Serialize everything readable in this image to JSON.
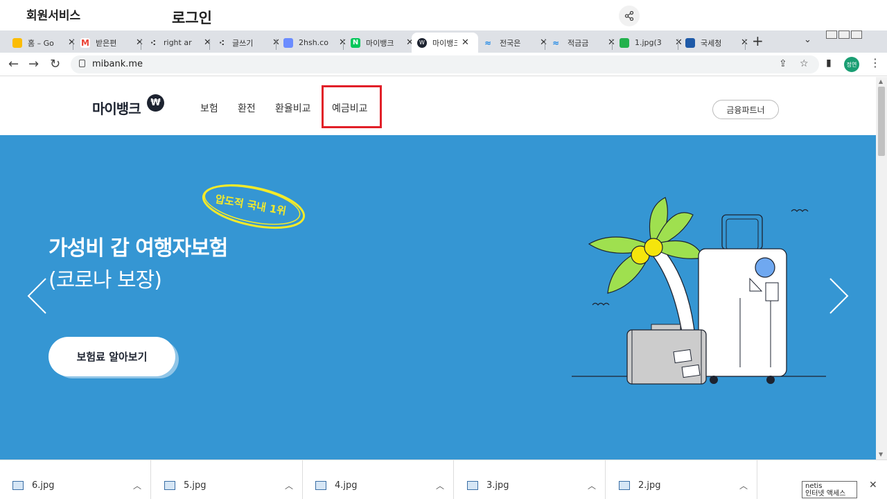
{
  "overlay": {
    "member_service": "회원서비스",
    "login": "로그인"
  },
  "tabs": [
    {
      "label": "홈 – Go",
      "icon": "google-ads-icon",
      "color": "#fbbc04"
    },
    {
      "label": "받은편",
      "icon": "gmail-icon",
      "color": "#ea4335"
    },
    {
      "label": "right ar",
      "icon": "tistory-icon",
      "color": "#333333"
    },
    {
      "label": "글쓰기",
      "icon": "tistory-icon",
      "color": "#333333"
    },
    {
      "label": "2hsh.co",
      "icon": "doc-icon",
      "color": "#6b8cff"
    },
    {
      "label": "마이뱅크",
      "icon": "naver-icon",
      "color": "#03c75a"
    },
    {
      "label": "마이뱅크",
      "icon": "mibank-icon",
      "color": "#1d2330"
    },
    {
      "label": "전국은",
      "icon": "bank-icon",
      "color": "#1e88e5"
    },
    {
      "label": "적금금",
      "icon": "bank-icon",
      "color": "#1e88e5"
    },
    {
      "label": "1.jpg(3",
      "icon": "image-icon",
      "color": "#22b14c"
    },
    {
      "label": "국세청",
      "icon": "nts-icon",
      "color": "#1e5aa8"
    }
  ],
  "address": {
    "url": "mibank.me"
  },
  "profile_initials": "정연",
  "site": {
    "logo": "마이뱅크",
    "logo_badge": "₩",
    "nav": [
      "보험",
      "환전",
      "환율비교",
      "예금비교"
    ],
    "partner_button": "금융파트너"
  },
  "hero": {
    "badge": "압도적 국내 1위",
    "title": "가성비 갑 여행자보험",
    "subtitle": "(코로나 보장)",
    "cta": "보험료 알아보기"
  },
  "downloads": [
    "6.jpg",
    "5.jpg",
    "4.jpg",
    "3.jpg",
    "2.jpg"
  ],
  "tray_popup": {
    "line1": "netis",
    "line2": "인터넷 액세스"
  },
  "colors": {
    "hero_bg": "#3596d3",
    "highlight": "#e11f28",
    "badge_yellow": "#f4ea2a",
    "palm_green": "#9fe04f"
  }
}
